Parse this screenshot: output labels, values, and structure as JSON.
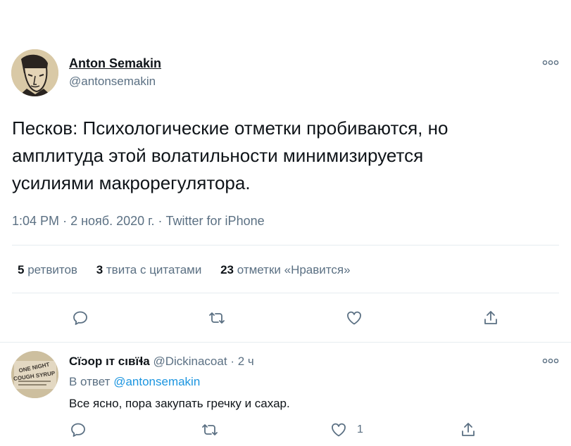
{
  "tweet": {
    "author_name": "Anton Semakin",
    "author_handle": "@antonsemakin",
    "text_lines": [
      "Песков: Психологические отметки пробиваются, но",
      "амплитуда этой волатильности минимизируется",
      "усилиями макрорегулятора."
    ],
    "time": "1:04 PM",
    "date": "2 нояб. 2020 г.",
    "source": "Twitter for iPhone",
    "dot": "·",
    "stats": {
      "retweets_count": "5",
      "retweets_label": "ретвитов",
      "quotes_count": "3",
      "quotes_label": "твита с цитатами",
      "likes_count": "23",
      "likes_label": "отметки «Нравится»"
    },
    "actions": [
      "reply-icon",
      "retweet-icon",
      "like-icon",
      "share-icon"
    ]
  },
  "reply": {
    "author_name": "Сїɔор ıт сıвїɬа",
    "author_handle": "@Dickinacoat",
    "time_ago": "2 ч",
    "reply_to_label": "В ответ",
    "reply_to_handle": "@antonsemakin",
    "text": "Все ясно, пора закупать гречку и сахар.",
    "like_count": "1",
    "avatar_text_top": "ONE NIGHT",
    "avatar_text_bottom": "COUGH SYRUP",
    "actions": [
      "reply-icon",
      "retweet-icon",
      "like-icon",
      "share-icon"
    ]
  },
  "colors": {
    "text": "#0f1419",
    "muted": "#5b7083",
    "link": "#1b95e0",
    "divider": "#e6ecf0"
  }
}
